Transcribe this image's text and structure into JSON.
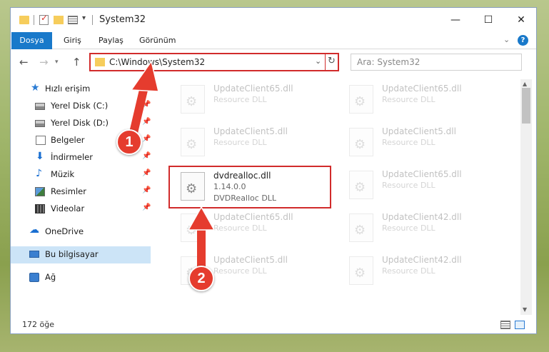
{
  "window": {
    "title": "System32",
    "controls": {
      "minimize": "—",
      "maximize": "☐",
      "close": "✕"
    }
  },
  "ribbon": {
    "tabs": [
      "Dosya",
      "Giriş",
      "Paylaş",
      "Görünüm"
    ],
    "help": "?"
  },
  "nav": {
    "address": "C:\\Windows\\System32",
    "search_placeholder": "Ara: System32"
  },
  "sidebar": {
    "items": [
      {
        "label": "Hızlı erişim",
        "icon": "star-icon"
      },
      {
        "label": "Yerel Disk (C:)",
        "icon": "drive-icon",
        "pinned": true
      },
      {
        "label": "Yerel Disk (D:)",
        "icon": "drive-icon",
        "pinned": true
      },
      {
        "label": "Belgeler",
        "icon": "document-icon",
        "pinned": true
      },
      {
        "label": "İndirmeler",
        "icon": "download-icon",
        "pinned": true
      },
      {
        "label": "Müzik",
        "icon": "music-icon",
        "pinned": true
      },
      {
        "label": "Resimler",
        "icon": "pictures-icon",
        "pinned": true
      },
      {
        "label": "Videolar",
        "icon": "videos-icon",
        "pinned": true
      },
      {
        "label": "OneDrive",
        "icon": "cloud-icon"
      },
      {
        "label": "Bu bilgisayar",
        "icon": "computer-icon",
        "selected": true
      },
      {
        "label": "Ağ",
        "icon": "network-icon"
      }
    ]
  },
  "files": {
    "left": [
      {
        "name": "UpdateClient65.dll",
        "desc": "Resource DLL"
      },
      {
        "name": "UpdateClient5.dll",
        "desc": "Resource DLL"
      },
      {
        "name": "dvdrealloc.dll",
        "version": "1.14.0.0",
        "desc": "DVDRealloc DLL"
      },
      {
        "name": "UpdateClient65.dll",
        "desc": "Resource DLL"
      },
      {
        "name": "UpdateClient5.dll",
        "desc": "Resource DLL"
      }
    ],
    "right": [
      {
        "name": "UpdateClient65.dll",
        "desc": "Resource DLL"
      },
      {
        "name": "UpdateClient5.dll",
        "desc": "Resource DLL"
      },
      {
        "name": "UpdateClient65.dll",
        "desc": "Resource DLL"
      },
      {
        "name": "UpdateClient42.dll",
        "desc": "Resource DLL"
      },
      {
        "name": "UpdateClient42.dll",
        "desc": "Resource DLL"
      }
    ]
  },
  "status": {
    "count": "172 öğe"
  },
  "annotations": {
    "step1": "1",
    "step2": "2",
    "accent": "#e53c2e"
  }
}
